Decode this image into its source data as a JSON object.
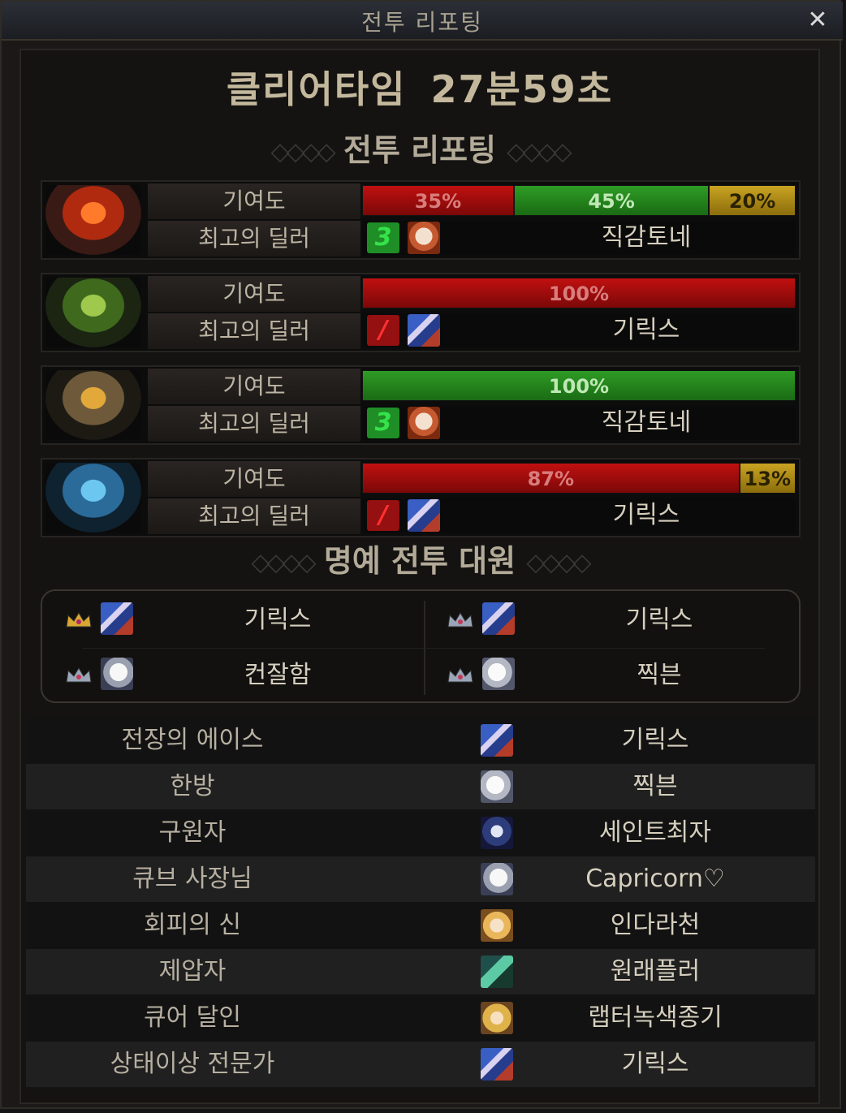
{
  "window": {
    "title": "전투 리포팅",
    "close_icon": "close-icon"
  },
  "clear_time": {
    "label": "클리어타임",
    "value": "27분59초"
  },
  "report_section": {
    "title": "전투 리포팅"
  },
  "bosses": [
    {
      "icon": "fire-boss-icon",
      "contribution_label": "기여도",
      "bars": [
        {
          "percent": 35,
          "label": "35%",
          "color": "red"
        },
        {
          "percent": 45,
          "label": "45%",
          "color": "green"
        },
        {
          "percent": 20,
          "label": "20%",
          "color": "yellow"
        }
      ],
      "dealer_label": "최고의 딜러",
      "dealer_badge": "3",
      "dealer_badge_color": "green",
      "dealer_avatar": "fox",
      "dealer_name": "직감토네"
    },
    {
      "icon": "nature-boss-icon",
      "contribution_label": "기여도",
      "bars": [
        {
          "percent": 100,
          "label": "100%",
          "color": "red"
        }
      ],
      "dealer_label": "최고의 딜러",
      "dealer_badge": "/",
      "dealer_badge_color": "red",
      "dealer_avatar": "blue",
      "dealer_name": "기릭스"
    },
    {
      "icon": "earth-boss-icon",
      "contribution_label": "기여도",
      "bars": [
        {
          "percent": 100,
          "label": "100%",
          "color": "green"
        }
      ],
      "dealer_label": "최고의 딜러",
      "dealer_badge": "3",
      "dealer_badge_color": "green",
      "dealer_avatar": "fox",
      "dealer_name": "직감토네"
    },
    {
      "icon": "ice-boss-icon",
      "contribution_label": "기여도",
      "bars": [
        {
          "percent": 87,
          "label": "87%",
          "color": "red"
        },
        {
          "percent": 13,
          "label": "13%",
          "color": "yellow"
        }
      ],
      "dealer_label": "최고의 딜러",
      "dealer_badge": "/",
      "dealer_badge_color": "red",
      "dealer_avatar": "blue",
      "dealer_name": "기릭스"
    }
  ],
  "honor_section": {
    "title": "명예 전투 대원"
  },
  "honor_members": [
    {
      "crown": "gold-crown-icon",
      "avatar": "blue",
      "name": "기릭스"
    },
    {
      "crown": "silver-crown-icon",
      "avatar": "blue",
      "name": "기릭스"
    },
    {
      "crown": "silver-crown-icon",
      "avatar": "white",
      "name": "컨잘함"
    },
    {
      "crown": "silver-crown-icon",
      "avatar": "silver",
      "name": "찍븐"
    }
  ],
  "awards": [
    {
      "title": "전장의 에이스",
      "avatar": "blue",
      "name": "기릭스"
    },
    {
      "title": "한방",
      "avatar": "silver",
      "name": "찍븐"
    },
    {
      "title": "구원자",
      "avatar": "dark",
      "name": "세인트최자"
    },
    {
      "title": "큐브 사장님",
      "avatar": "white",
      "name": "Capricorn♡"
    },
    {
      "title": "회피의 신",
      "avatar": "blond",
      "name": "인다라천"
    },
    {
      "title": "제압자",
      "avatar": "green",
      "name": "원래플러"
    },
    {
      "title": "큐어 달인",
      "avatar": "gold",
      "name": "랩터녹색종기"
    },
    {
      "title": "상태이상 전문가",
      "avatar": "blue",
      "name": "기릭스"
    }
  ]
}
